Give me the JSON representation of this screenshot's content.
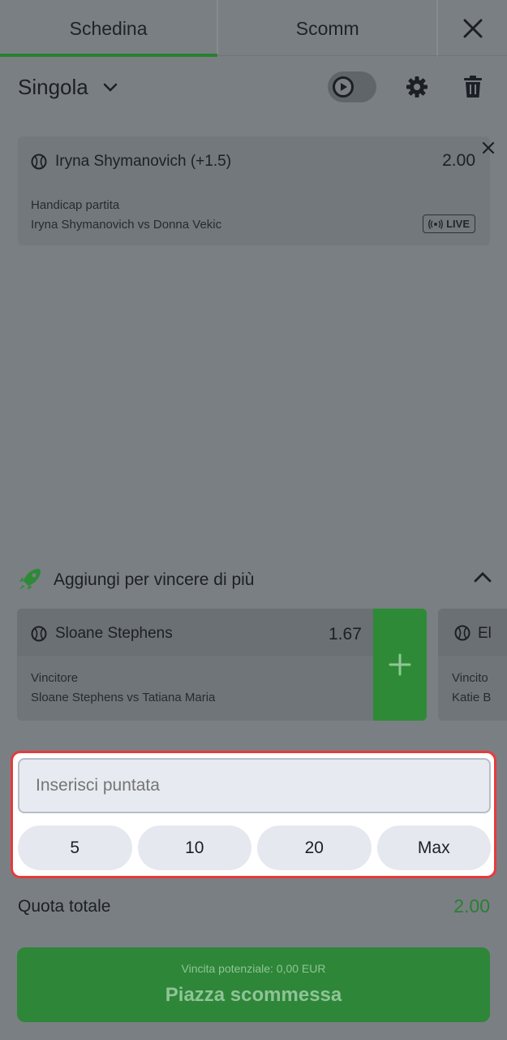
{
  "tabs": {
    "betslip": "Schedina",
    "bets": "Scomm"
  },
  "toolbar": {
    "bet_type": "Singola"
  },
  "selection": {
    "name": "Iryna Shymanovich (+1.5)",
    "odds": "2.00",
    "market": "Handicap partita",
    "event": "Iryna Shymanovich vs Donna Vekic",
    "live_badge": "LIVE"
  },
  "boost": {
    "label": "Aggiungi per vincere di più"
  },
  "suggestions": [
    {
      "name": "Sloane Stephens",
      "odds": "1.67",
      "market": "Vincitore",
      "event": "Sloane Stephens vs Tatiana Maria"
    },
    {
      "name": "El",
      "market": "Vincito",
      "event": "Katie B"
    }
  ],
  "stake": {
    "placeholder": "Inserisci puntata",
    "chips": [
      "5",
      "10",
      "20",
      "Max"
    ]
  },
  "total": {
    "label": "Quota totale",
    "value": "2.00"
  },
  "place": {
    "potential": "Vincita potenziale: 0,00  EUR",
    "label": "Piazza scommessa"
  },
  "colors": {
    "accent_green": "#27812f",
    "highlight_border": "#e63b3b"
  }
}
